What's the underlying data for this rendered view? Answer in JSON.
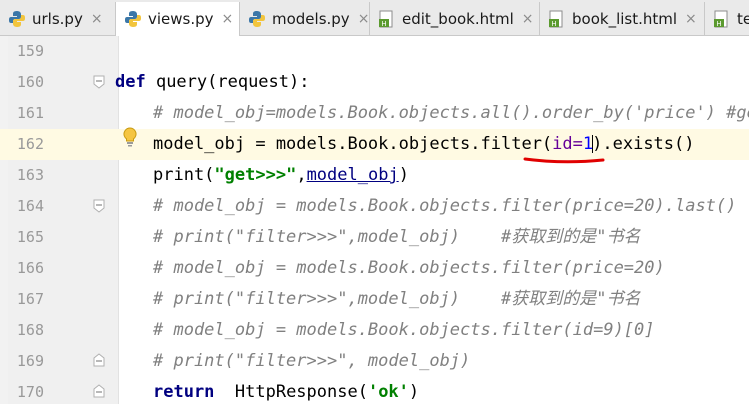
{
  "tabs": [
    {
      "label": "urls.py",
      "icon": "python-file-icon",
      "close": "×"
    },
    {
      "label": "views.py",
      "icon": "python-file-icon",
      "close": "×"
    },
    {
      "label": "models.py",
      "icon": "python-file-icon",
      "close": "×"
    },
    {
      "label": "edit_book.html",
      "icon": "html-file-icon",
      "close": "×"
    },
    {
      "label": "book_list.html",
      "icon": "html-file-icon",
      "close": "×"
    },
    {
      "label": "te",
      "icon": "html-file-icon",
      "close": ""
    }
  ],
  "line_numbers": [
    "159",
    "160",
    "161",
    "162",
    "163",
    "164",
    "165",
    "166",
    "167",
    "168",
    "169",
    "170"
  ],
  "code": {
    "l160": {
      "def": "def",
      "rest": " query(request):"
    },
    "l161": "# model_obj=models.Book.objects.all().order_by('price') #get",
    "l162": {
      "pre": "model_obj = models.Book.objects.filter(",
      "param": "id=",
      "num": "1",
      "post": ").exists()"
    },
    "l163": {
      "pre": "print(",
      "str": "\"get>>>\"",
      "comma": ",",
      "link": "model_obj",
      "post": ")"
    },
    "l164": "# model_obj = models.Book.objects.filter(price=20).last()",
    "l165": "# print(\"filter>>>\",model_obj)    #获取到的是\"书名",
    "l166": "# model_obj = models.Book.objects.filter(price=20)",
    "l167": "# print(\"filter>>>\",model_obj)    #获取到的是\"书名",
    "l168": "# model_obj = models.Book.objects.filter(id=9)[0]",
    "l169": "# print(\"filter>>>\", model_obj)",
    "l170": {
      "ret": "return",
      "rest": "  HttpResponse(",
      "str": "'ok'",
      "post": ")"
    }
  },
  "colors": {
    "keyword": "#000080",
    "comment": "#808080",
    "string": "#008000",
    "current_line": "#fffae3",
    "annotation": "#e00000"
  },
  "icons": {
    "intention": "lightbulb-icon",
    "fold": "fold-marker-icon"
  }
}
